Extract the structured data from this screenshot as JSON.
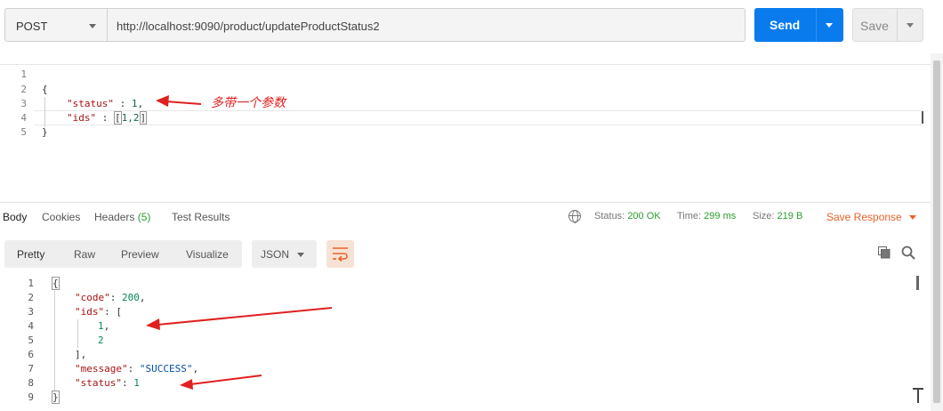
{
  "request": {
    "method": "POST",
    "url": "http://localhost:9090/product/updateProductStatus2",
    "send_label": "Send",
    "save_label": "Save"
  },
  "request_body": {
    "line_numbers": [
      "1",
      "2",
      "3",
      "4",
      "5"
    ],
    "lines": {
      "l2": "{",
      "l3_key": "\"status\"",
      "l3_sep": " : ",
      "l3_val": "1",
      "l3_end": ",",
      "l4_key": "\"ids\"",
      "l4_sep": " : ",
      "l4_open": "[",
      "l4_val": "1,2",
      "l4_close": "]",
      "l5": "}"
    },
    "annotation": "多带一个参数"
  },
  "response_tabs": {
    "body": "Body",
    "cookies": "Cookies",
    "headers": "Headers",
    "headers_count": "(5)",
    "test_results": "Test Results"
  },
  "response_status": {
    "status_label": "Status:",
    "status_value": "200 OK",
    "time_label": "Time:",
    "time_value": "299 ms",
    "size_label": "Size:",
    "size_value": "219 B",
    "save_response": "Save Response"
  },
  "response_toolbar": {
    "views": [
      "Pretty",
      "Raw",
      "Preview",
      "Visualize"
    ],
    "format": "JSON"
  },
  "response_body": {
    "line_numbers": [
      "1",
      "2",
      "3",
      "4",
      "5",
      "6",
      "7",
      "8",
      "9"
    ],
    "l1": "{",
    "l2_key": "\"code\"",
    "l2_val": "200",
    "l3_key": "\"ids\"",
    "l3_open": "[",
    "l4_val": "1",
    "l5_val": "2",
    "l6": "],",
    "l7_key": "\"message\"",
    "l7_val": "\"SUCCESS\"",
    "l8_key": "\"status\"",
    "l8_val": "1",
    "l9": "}"
  },
  "colors": {
    "send": "#097bed",
    "accent_orange": "#e8632b",
    "status_ok": "#2c9d2c",
    "annotation": "#e02020"
  }
}
